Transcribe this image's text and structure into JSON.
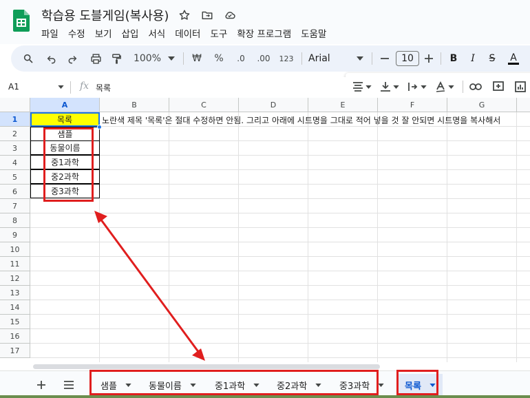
{
  "app": {
    "doc_title": "학습용 도블게임(복사용)",
    "menu": [
      "파일",
      "수정",
      "보기",
      "삽입",
      "서식",
      "데이터",
      "도구",
      "확장 프로그램",
      "도움말"
    ]
  },
  "toolbar": {
    "zoom": "100%",
    "currency": "₩",
    "percent": "%",
    "dec_decrease": ".0",
    "dec_increase": ".00",
    "number_format": "123",
    "font_name": "Arial",
    "font_size": "10",
    "bold": "B",
    "italic": "I",
    "strike": "S",
    "text_color": "A"
  },
  "formula_bar": {
    "cell_ref": "A1",
    "fx": "fx",
    "value": "목록"
  },
  "grid": {
    "columns": [
      "A",
      "B",
      "C",
      "D",
      "E",
      "F",
      "G"
    ],
    "rows": [
      "1",
      "2",
      "3",
      "4",
      "5",
      "6",
      "7",
      "8",
      "9",
      "10",
      "11",
      "12",
      "13",
      "14",
      "15",
      "16",
      "17"
    ],
    "a_cells": [
      "목록",
      "샘플",
      "동물이름",
      "중1과학",
      "중2과학",
      "중3과학"
    ],
    "b1_note": "노란색 제목 '목록'은 절대 수정하면 안됨. 그리고 아래에 시트명을 그대로 적어 넣을 것 잘 안되면 시트명을 복사해서"
  },
  "tabs": {
    "sheets": [
      "샘플",
      "동물이름",
      "중1과학",
      "중2과학",
      "중3과학",
      "목록"
    ],
    "active": "목록"
  },
  "colors": {
    "header_yellow": "#ffff00",
    "annotation_red": "#e01e1e",
    "accent_blue": "#0b57d0"
  }
}
